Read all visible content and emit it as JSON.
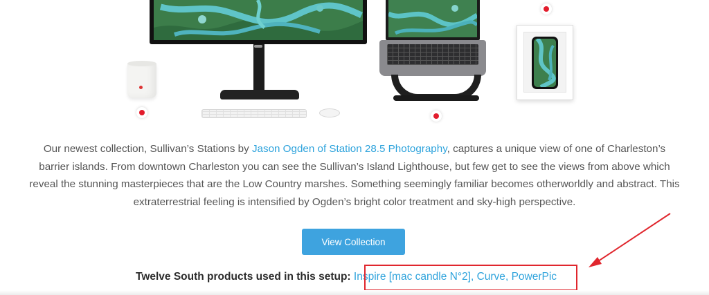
{
  "description": {
    "before_link": "Our newest collection, Sullivan’s Stations by ",
    "link_text": "Jason Ogden of Station 28.5 Photography",
    "after_link": ", captures a unique view of one of Charleston’s barrier islands. From downtown Charleston you can see the Sullivan’s Island Lighthouse, but few get to see the views from above which reveal the stunning masterpieces that are the Low Country marshes. Something seemingly familiar becomes otherworldly and abstract. This extraterrestrial feeling is intensified by Ogden’s bright color treatment and sky-high perspective."
  },
  "cta": {
    "label": "View Collection"
  },
  "products": {
    "lead": "Twelve South products used in this setup:",
    "links": [
      "Inspire [mac candle N°2]",
      "Curve",
      "PowerPic"
    ],
    "separator": ", "
  },
  "colors": {
    "accent": "#3ea3df",
    "link": "#2ea3dc",
    "hotspot": "#e21c2c",
    "annotation": "#e0262d"
  }
}
